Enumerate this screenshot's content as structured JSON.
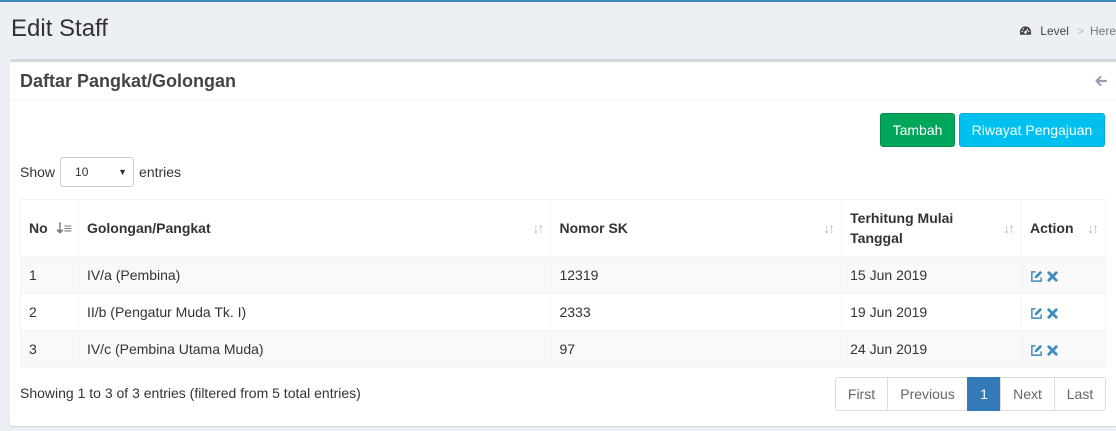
{
  "header": {
    "title": "Edit Staff",
    "breadcrumb": {
      "icon": "dashboard-icon",
      "level": "Level",
      "separator": ">",
      "here": "Here"
    }
  },
  "box": {
    "title": "Daftar Pangkat/Golongan",
    "back_icon": "arrow-left-icon",
    "buttons": {
      "tambah": "Tambah",
      "riwayat": "Riwayat Pengajuan"
    }
  },
  "length": {
    "show": "Show",
    "value": "10",
    "entries": "entries"
  },
  "table": {
    "headers": {
      "no": "No",
      "golongan": "Golongan/Pangkat",
      "nomor_sk": "Nomor SK",
      "tanggal_1": "Terhitung Mulai",
      "tanggal_2": "Tanggal",
      "action": "Action"
    },
    "rows": [
      {
        "no": "1",
        "golongan": "IV/a (Pembina)",
        "nomor_sk": "12319",
        "tanggal": "15 Jun 2019"
      },
      {
        "no": "2",
        "golongan": "II/b (Pengatur Muda Tk. I)",
        "nomor_sk": "2333",
        "tanggal": "19 Jun 2019"
      },
      {
        "no": "3",
        "golongan": "IV/c (Pembina Utama Muda)",
        "nomor_sk": "97",
        "tanggal": "24 Jun 2019"
      }
    ]
  },
  "info": "Showing 1 to 3 of 3 entries (filtered from 5 total entries)",
  "pagination": {
    "first": "First",
    "previous": "Previous",
    "current": "1",
    "next": "Next",
    "last": "Last"
  },
  "colors": {
    "primary": "#3c8dbc",
    "success": "#00a65a",
    "info": "#00c0ef",
    "page_active": "#337ab7"
  }
}
